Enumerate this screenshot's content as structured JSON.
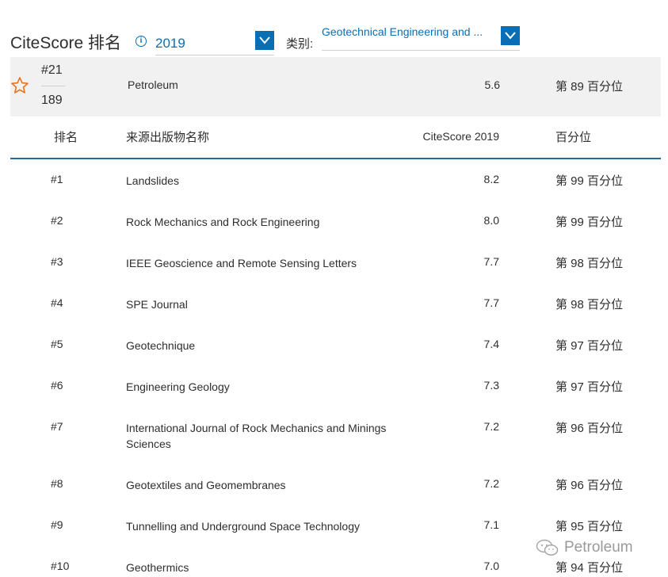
{
  "header": {
    "title": "CiteScore 排名",
    "year_value": "2019",
    "category_label": "类别:",
    "category_value": "Geotechnical Engineering and ..."
  },
  "highlight": {
    "rank": "#21",
    "total": "189",
    "name": "Petroleum",
    "score": "5.6",
    "percentile": "第 89 百分位"
  },
  "table": {
    "headers": {
      "rank": "排名",
      "name": "来源出版物名称",
      "score": "CiteScore 2019",
      "percentile": "百分位"
    },
    "rows": [
      {
        "rank": "#1",
        "name": "Landslides",
        "score": "8.2",
        "percentile": "第 99 百分位"
      },
      {
        "rank": "#2",
        "name": "Rock Mechanics and Rock Engineering",
        "score": "8.0",
        "percentile": "第 99 百分位"
      },
      {
        "rank": "#3",
        "name": "IEEE Geoscience and Remote Sensing Letters",
        "score": "7.7",
        "percentile": "第 98 百分位"
      },
      {
        "rank": "#4",
        "name": "SPE Journal",
        "score": "7.7",
        "percentile": "第 98 百分位"
      },
      {
        "rank": "#5",
        "name": "Geotechnique",
        "score": "7.4",
        "percentile": "第 97 百分位"
      },
      {
        "rank": "#6",
        "name": "Engineering Geology",
        "score": "7.3",
        "percentile": "第 97 百分位"
      },
      {
        "rank": "#7",
        "name": "International Journal of Rock Mechanics and Minings Sciences",
        "score": "7.2",
        "percentile": "第 96 百分位"
      },
      {
        "rank": "#8",
        "name": "Geotextiles and Geomembranes",
        "score": "7.2",
        "percentile": "第 96 百分位"
      },
      {
        "rank": "#9",
        "name": "Tunnelling and Underground Space Technology",
        "score": "7.1",
        "percentile": "第 95 百分位"
      },
      {
        "rank": "#10",
        "name": "Geothermics",
        "score": "7.0",
        "percentile": "第 94 百分位"
      }
    ]
  },
  "watermark": {
    "text": "Petroleum",
    "icon": "wechat-icon"
  },
  "colors": {
    "accent": "#0a6eb4",
    "star": "#e9711c",
    "header_rule": "#1f6a9a",
    "highlight_bg": "#f1f1f1"
  }
}
